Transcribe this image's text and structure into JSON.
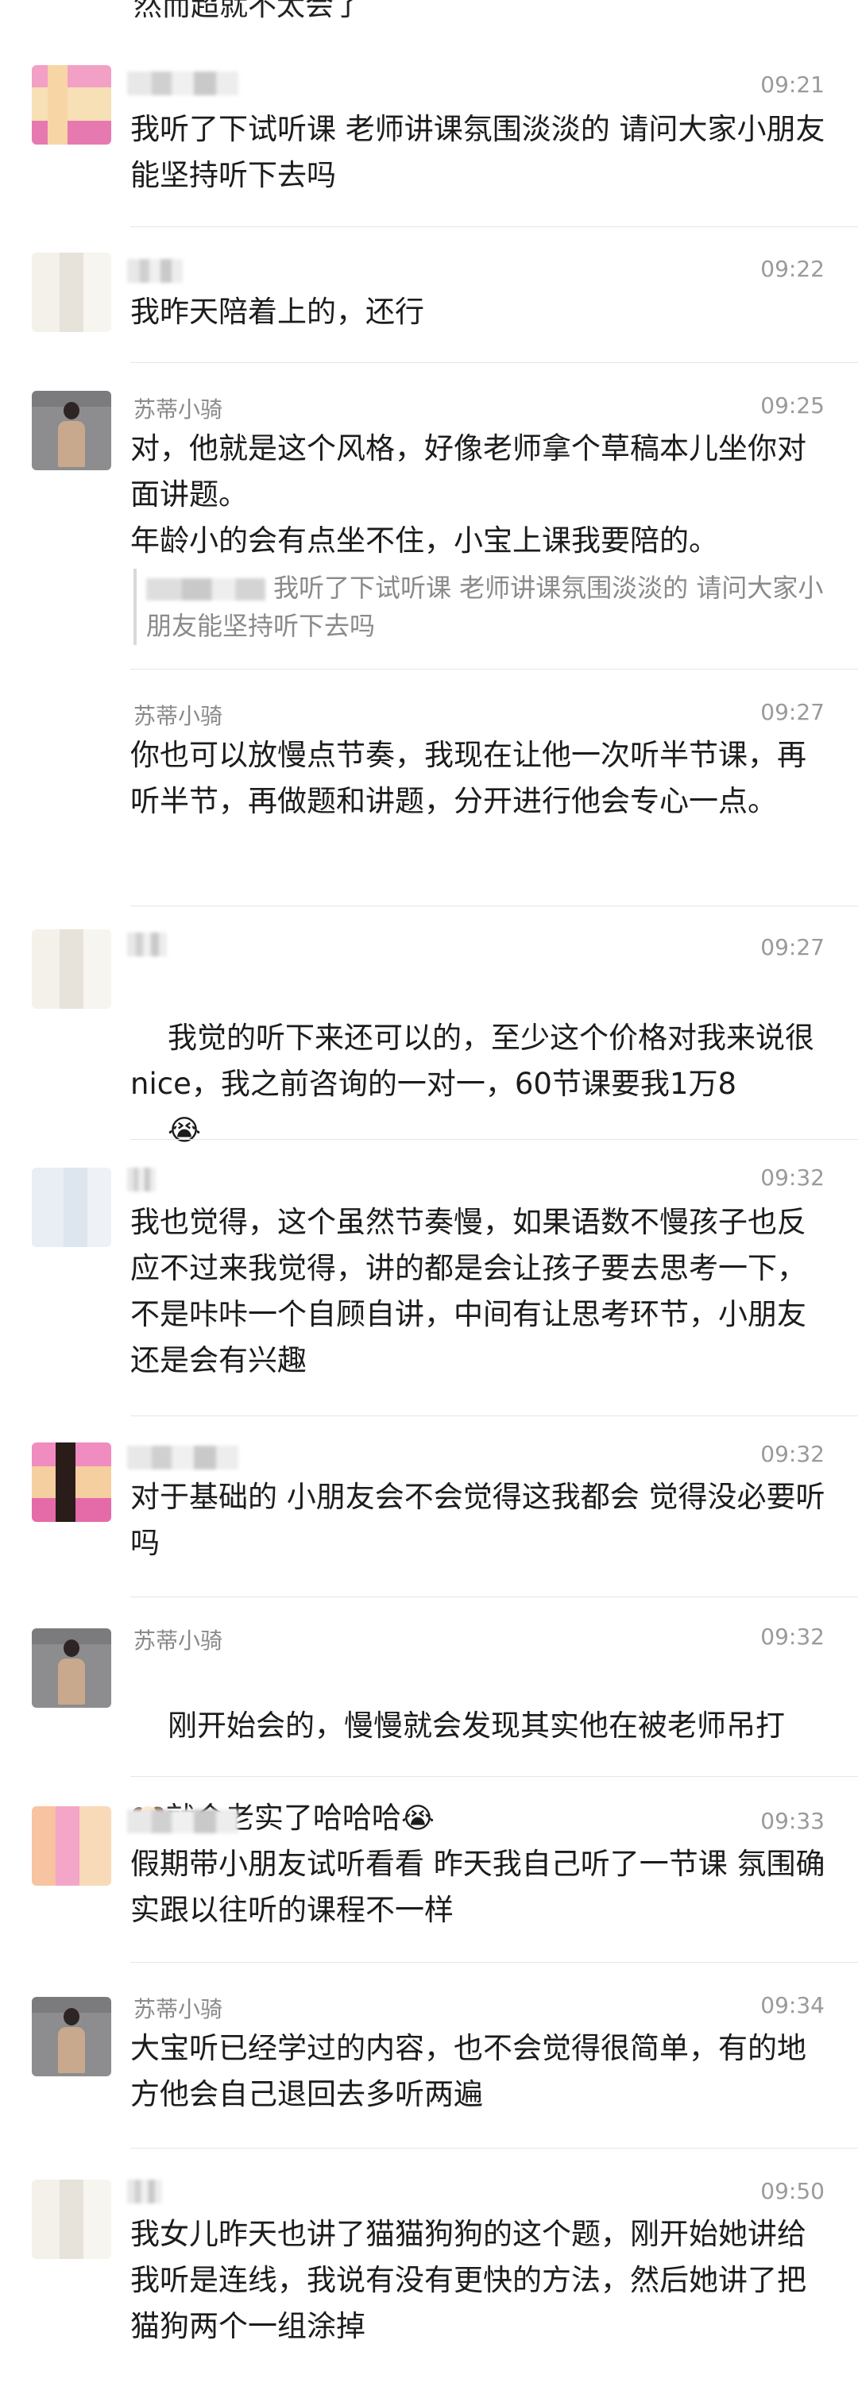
{
  "top_fragment": "然而超就不太会了",
  "messages": [
    {
      "avatar": "blurred-pink-avatar",
      "name": "",
      "time": "09:21",
      "text": "我听了下试听课 老师讲课氛围淡淡的 请问大家小朋友能坚持听下去吗"
    },
    {
      "avatar": "blurred-light-avatar",
      "name": "",
      "time": "09:22",
      "text": "我昨天陪着上的，还行"
    },
    {
      "avatar": "person-photo-avatar",
      "name": "苏蒂小骑",
      "time": "09:25",
      "text": "对，他就是这个风格，好像老师拿个草稿本儿坐你对面讲题。\n年龄小的会有点坐不住，小宝上课我要陪的。",
      "quote": "我听了下试听课 老师讲课氛围淡淡的 请问大家小朋友能坚持听下去吗"
    },
    {
      "avatar": "none",
      "name": "苏蒂小骑",
      "time": "09:27",
      "text": "你也可以放慢点节奏，我现在让他一次听半节课，再听半节，再做题和讲题，分开进行他会专心一点。"
    },
    {
      "avatar": "blurred-light-avatar",
      "name": "",
      "time": "09:27",
      "text": "我觉的听下来还可以的，至少这个价格对我来说很nice，我之前咨询的一对一，60节课要我1万8",
      "emoji": "😭"
    },
    {
      "avatar": "blurred-blue-avatar",
      "name": "",
      "time": "09:32",
      "text": "我也觉得，这个虽然节奏慢，如果语数不慢孩子也反应不过来我觉得，讲的都是会让孩子要去思考一下，不是咔咔一个自顾自讲，中间有让思考环节，小朋友还是会有兴趣"
    },
    {
      "avatar": "blurred-pink-dark-avatar",
      "name": "",
      "time": "09:32",
      "text": "对于基础的 小朋友会不会觉得这我都会 觉得没必要听吗"
    },
    {
      "avatar": "person-photo-avatar",
      "name": "苏蒂小骑",
      "time": "09:32",
      "text": "刚开始会的，慢慢就会发现其实他在被老师吊打",
      "text2": "就会老实了哈哈哈",
      "emoji_pre": "🐶",
      "emoji": "😭"
    },
    {
      "avatar": "blurred-pink-yellow-avatar",
      "name": "",
      "time": "09:33",
      "text": "假期带小朋友试听看看 昨天我自己听了一节课 氛围确实跟以往听的课程不一样"
    },
    {
      "avatar": "person-photo-avatar",
      "name": "苏蒂小骑",
      "time": "09:34",
      "text": "大宝听已经学过的内容，也不会觉得很简单，有的地方他会自己退回去多听两遍"
    },
    {
      "avatar": "blurred-light-avatar",
      "name": "",
      "time": "09:50",
      "text": "我女儿昨天也讲了猫猫狗狗的这个题，刚开始她讲给我听是连线，我说有没有更快的方法，然后她讲了把猫狗两个一组涂掉"
    }
  ]
}
